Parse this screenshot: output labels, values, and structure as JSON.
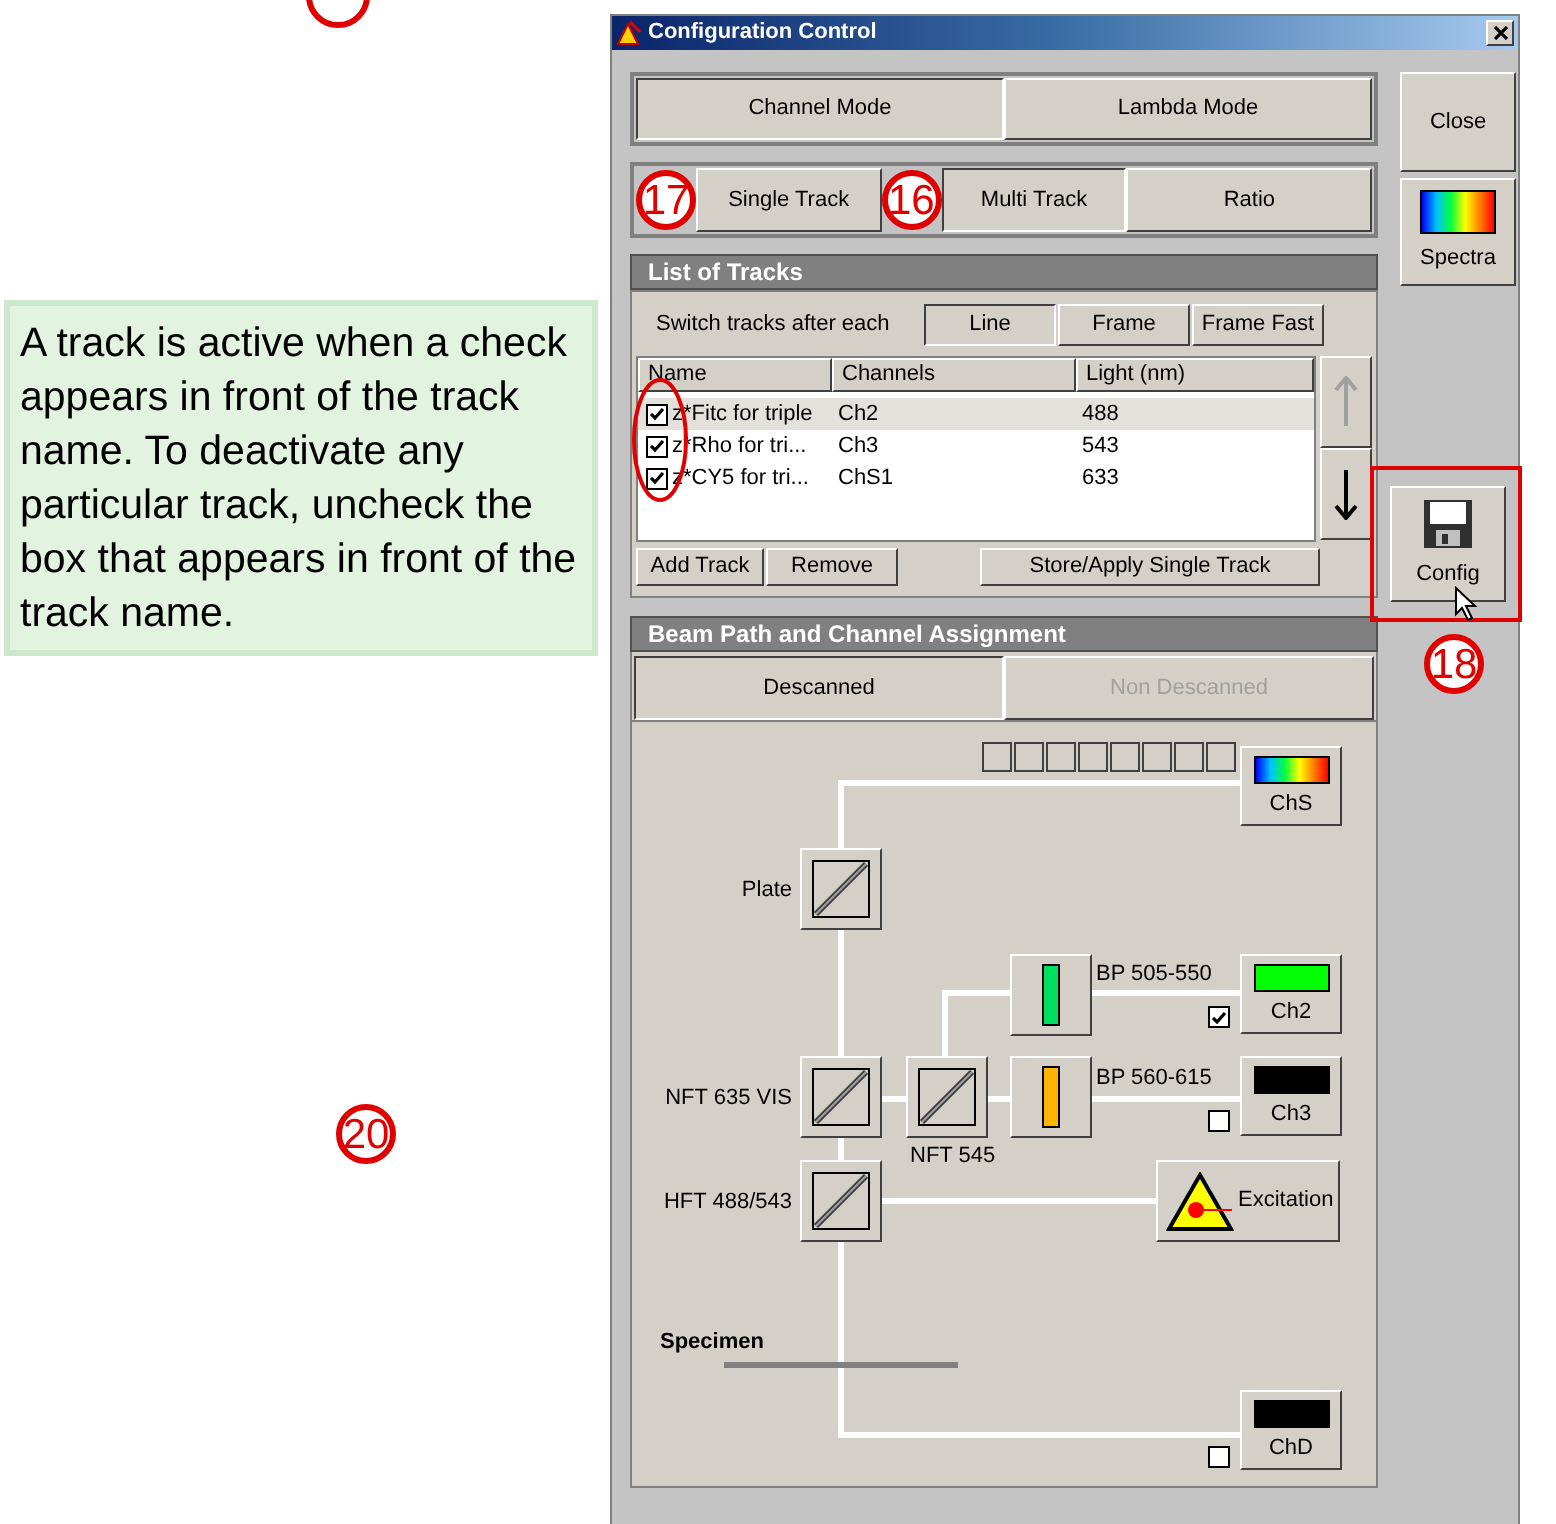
{
  "note": "A track is active when a check appears in front of the track name. To deactivate any particular track, uncheck the box that appears in front of the track name.",
  "window": {
    "title": "Configuration Control"
  },
  "modes": [
    {
      "label": "Channel Mode",
      "selected": true
    },
    {
      "label": "Lambda Mode",
      "selected": false
    }
  ],
  "track_modes": [
    {
      "label": "Single Track",
      "selected": false,
      "callout": "17"
    },
    {
      "label": "Multi Track",
      "selected": true,
      "callout": "16"
    },
    {
      "label": "Ratio",
      "selected": false
    }
  ],
  "side_buttons": [
    {
      "label": "Close",
      "kind": "text",
      "highlighted": false
    },
    {
      "label": "Spectra",
      "kind": "spectrum",
      "highlighted": false
    },
    {
      "label": "Config",
      "kind": "disk",
      "highlighted": true,
      "callout": "18"
    }
  ],
  "tracks": {
    "title": "List of Tracks",
    "switch_label": "Switch tracks after each",
    "switch_options": [
      {
        "label": "Line",
        "selected": true
      },
      {
        "label": "Frame",
        "selected": false
      },
      {
        "label": "Frame Fast",
        "selected": false
      }
    ],
    "columns": [
      "Name",
      "Channels",
      "Light (nm)"
    ],
    "rows": [
      {
        "name": "z*Fitc for triple",
        "channels": "Ch2",
        "light": "488",
        "checked": true,
        "selected": true
      },
      {
        "name": "z*Rho for tri...",
        "channels": "Ch3",
        "light": "543",
        "checked": true,
        "selected": false
      },
      {
        "name": "z*CY5 for tri...",
        "channels": "ChS1",
        "light": "633",
        "checked": true,
        "selected": false
      }
    ],
    "move_buttons": [
      {
        "kind": "up",
        "disabled": true
      },
      {
        "kind": "down",
        "disabled": false
      }
    ],
    "buttons": [
      "Add Track",
      "Remove",
      "Store/Apply Single Track"
    ]
  },
  "beam_path": {
    "title": "Beam Path and Channel Assignment",
    "tabs": [
      {
        "label": "Descanned",
        "selected": true,
        "disabled": false
      },
      {
        "label": "Non Descanned",
        "selected": false,
        "disabled": true
      }
    ],
    "detectors": [
      {
        "label": "ChS",
        "kind": "spectrum"
      },
      {
        "label": "Ch2",
        "kind": "color",
        "color": "#00ff00",
        "checked": true
      },
      {
        "label": "Ch3",
        "kind": "color",
        "color": "#000000",
        "checked": false
      },
      {
        "label": "ChD",
        "kind": "color",
        "color": "#000000",
        "checked": false
      }
    ],
    "mirrors": [
      {
        "label": "Plate"
      },
      {
        "label": "NFT 635 VIS"
      },
      {
        "label": "NFT 545"
      },
      {
        "label": "HFT 488/543"
      }
    ],
    "filters": [
      {
        "label": "BP 505-550",
        "color": "#00e060"
      },
      {
        "label": "BP 560-615",
        "color": "#ffb400"
      }
    ],
    "excitation": {
      "label": "Excitation"
    },
    "specimen": {
      "label": "Specimen"
    }
  },
  "page_callouts": [
    {
      "label": "20"
    }
  ]
}
